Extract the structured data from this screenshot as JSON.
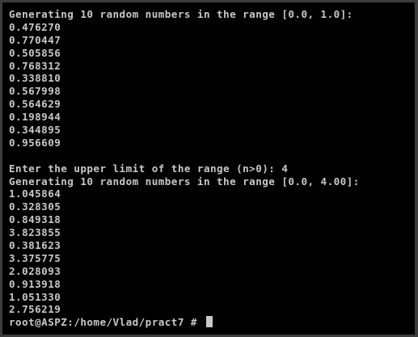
{
  "terminal": {
    "lines": [
      "Generating 10 random numbers in the range [0.0, 1.0]:",
      "0.476270",
      "0.770447",
      "0.505856",
      "0.768312",
      "0.338810",
      "0.567998",
      "0.564629",
      "0.198944",
      "0.344895",
      "0.956609",
      "",
      "Enter the upper limit of the range (n>0): 4",
      "Generating 10 random numbers in the range [0.0, 4.00]:",
      "1.045864",
      "0.328305",
      "0.849318",
      "3.823855",
      "0.381623",
      "3.375775",
      "2.028093",
      "0.913918",
      "1.051330",
      "2.756219"
    ],
    "prompt": "root@ASPZ:/home/Vlad/pract7 # "
  }
}
